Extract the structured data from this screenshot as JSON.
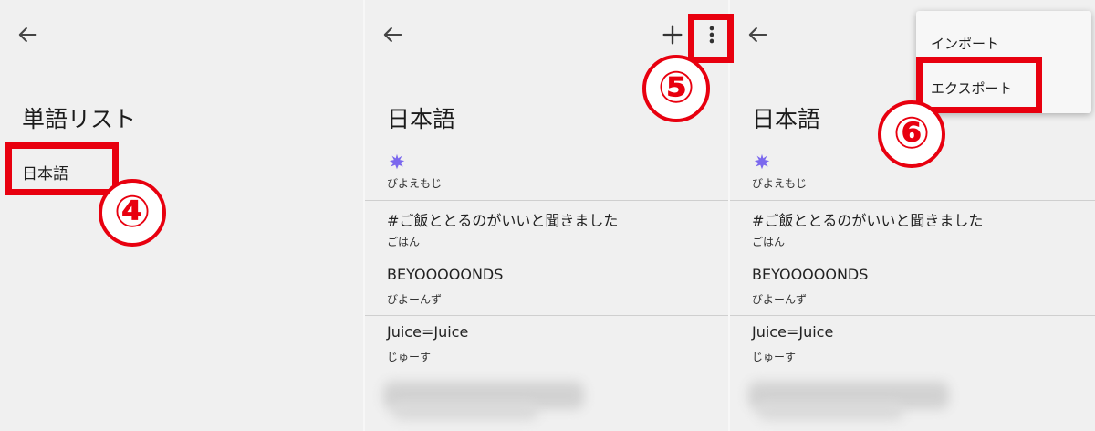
{
  "panel1": {
    "title": "単語リスト",
    "list_item": "日本語",
    "step_label": "④"
  },
  "panel2": {
    "title": "日本語",
    "step_label": "⑤",
    "entries": [
      {
        "text": "",
        "sub": "びよえもじ",
        "icon": "splat-icon"
      },
      {
        "text": "#ご飯ととるのがいいと聞きました",
        "sub": "ごはん"
      },
      {
        "text": "BEYOOOOONDS",
        "sub": "びよーんず"
      },
      {
        "text": "Juice=Juice",
        "sub": "じゅーす"
      }
    ]
  },
  "panel3": {
    "title": "日本語",
    "step_label": "⑥",
    "entries": [
      {
        "text": "",
        "sub": "びよえもじ",
        "icon": "splat-icon"
      },
      {
        "text": "#ご飯ととるのがいいと聞きました",
        "sub": "ごはん"
      },
      {
        "text": "BEYOOOOONDS",
        "sub": "びよーんず"
      },
      {
        "text": "Juice=Juice",
        "sub": "じゅーす"
      }
    ],
    "menu": {
      "import_label": "インポート",
      "export_label": "エクスポート"
    }
  },
  "colors": {
    "highlight": "#e8000f",
    "splat": "#7b68ee",
    "background": "#f0f0f0"
  }
}
